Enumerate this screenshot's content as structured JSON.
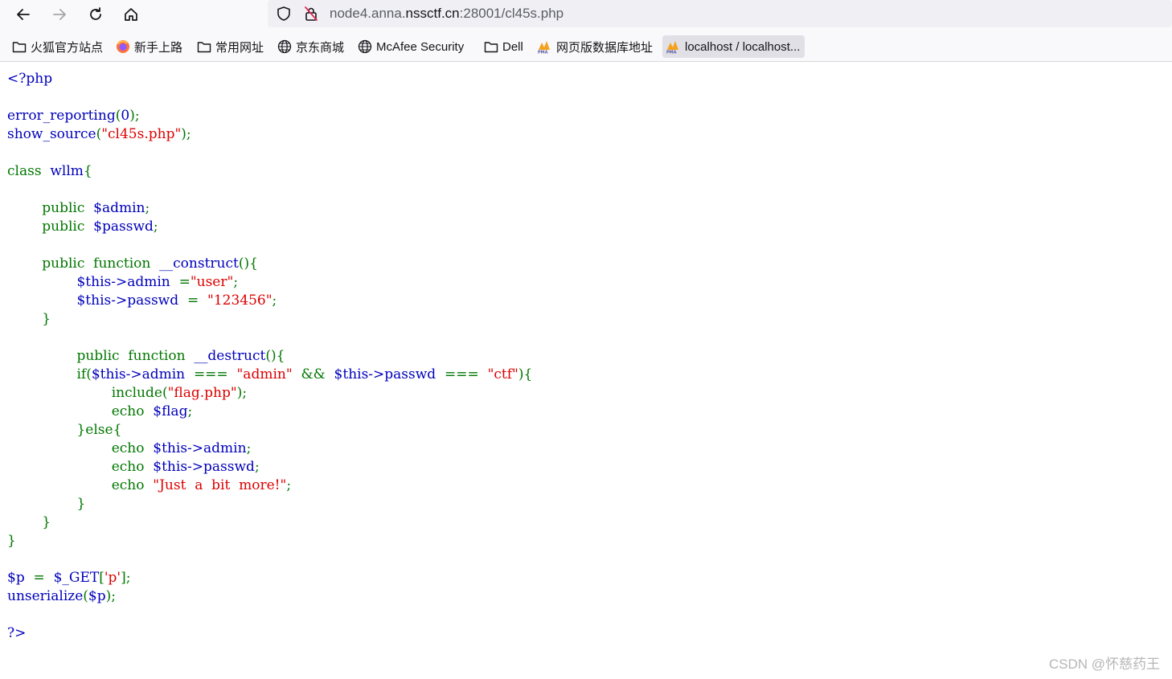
{
  "browser": {
    "url_prefix": "node4.anna.",
    "url_host": "nssctf.cn",
    "url_suffix": ":28001/cl45s.php"
  },
  "bookmarks": [
    {
      "label": "火狐官方站点",
      "icon": "folder-icon"
    },
    {
      "label": "新手上路",
      "icon": "firefox-icon"
    },
    {
      "label": "常用网址",
      "icon": "folder-icon"
    },
    {
      "label": "京东商城",
      "icon": "globe-icon"
    },
    {
      "label": "McAfee Security",
      "icon": "globe-icon"
    },
    {
      "label": "Dell",
      "icon": "folder-icon"
    },
    {
      "label": "网页版数据库地址",
      "icon": "phpmyadmin-icon"
    },
    {
      "label": "localhost / localhost...",
      "icon": "phpmyadmin-icon"
    }
  ],
  "code": {
    "open_tag": "<?php",
    "l_err_fn": "error_reporting",
    "l_err_arg": "0",
    "l_src_fn": "show_source",
    "l_src_arg": "\"cl45s.php\"",
    "l_class_kw": "class",
    "l_class_name": "wllm",
    "kw_public": "public",
    "kw_function": "function",
    "var_admin": "$admin",
    "var_passwd": "$passwd",
    "fn_construct": "__construct",
    "this_admin": "$this->admin",
    "this_passwd": "$this->passwd",
    "str_user": "\"user\"",
    "str_123456": "\"123456\"",
    "fn_destruct": "__destruct",
    "kw_if": "if",
    "op_strict": "===",
    "str_admin": "\"admin\"",
    "op_and": "&&",
    "str_ctf": "\"ctf\"",
    "kw_include": "include",
    "str_flag_php": "\"flag.php\"",
    "kw_echo": "echo",
    "var_flag": "$flag",
    "kw_else": "else",
    "str_more": "\"Just  a  bit  more!\"",
    "var_p": "$p",
    "var_get": "$_GET",
    "str_p_key": "'p'",
    "fn_unserialize": "unserialize",
    "close_tag": "?>"
  },
  "watermark": "CSDN @怀慈药王"
}
